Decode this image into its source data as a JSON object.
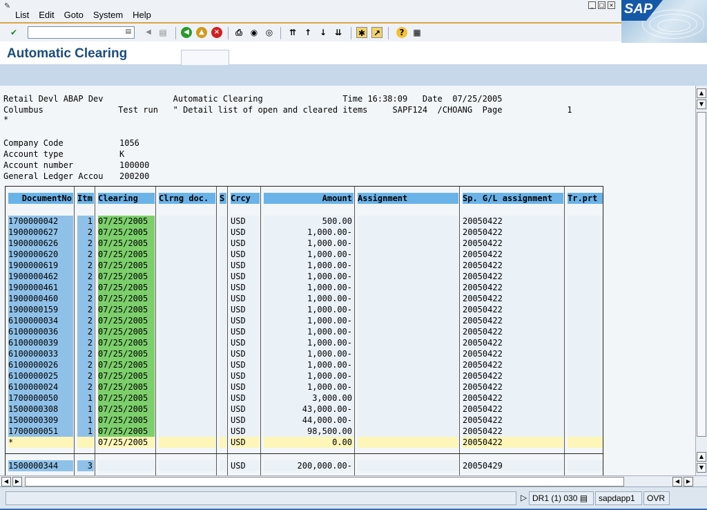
{
  "menu": {
    "items": [
      "List",
      "Edit",
      "Goto",
      "System",
      "Help"
    ]
  },
  "title": "Automatic Clearing",
  "report": {
    "line1": "Retail Devl ABAP Dev              Automatic Clearing                Time 16:38:09   Date  07/25/2005",
    "line2": "Columbus               Test run   \" Detail list of open and cleared items     SAPF124  /CHOANG  Page             1",
    "line3": "*",
    "header_fields": [
      {
        "label": "Company Code",
        "value": "1056"
      },
      {
        "label": "Account type",
        "value": "K"
      },
      {
        "label": "Account number",
        "value": "100000"
      },
      {
        "label": "General Ledger Accou",
        "value": "200200"
      }
    ]
  },
  "table": {
    "headers": [
      "DocumentNo",
      "Itm",
      "Clearing",
      "Clrng doc.",
      "S",
      "Crcy",
      "Amount",
      "Assignment",
      "Sp. G/L assignment",
      "Tr.prt"
    ],
    "rows": [
      [
        "1700000042",
        "1",
        "07/25/2005",
        "",
        "",
        "USD",
        "500.00",
        "",
        "20050422",
        ""
      ],
      [
        "1900000627",
        "2",
        "07/25/2005",
        "",
        "",
        "USD",
        "1,000.00-",
        "",
        "20050422",
        ""
      ],
      [
        "1900000626",
        "2",
        "07/25/2005",
        "",
        "",
        "USD",
        "1,000.00-",
        "",
        "20050422",
        ""
      ],
      [
        "1900000620",
        "2",
        "07/25/2005",
        "",
        "",
        "USD",
        "1,000.00-",
        "",
        "20050422",
        ""
      ],
      [
        "1900000619",
        "2",
        "07/25/2005",
        "",
        "",
        "USD",
        "1,000.00-",
        "",
        "20050422",
        ""
      ],
      [
        "1900000462",
        "2",
        "07/25/2005",
        "",
        "",
        "USD",
        "1,000.00-",
        "",
        "20050422",
        ""
      ],
      [
        "1900000461",
        "2",
        "07/25/2005",
        "",
        "",
        "USD",
        "1,000.00-",
        "",
        "20050422",
        ""
      ],
      [
        "1900000460",
        "2",
        "07/25/2005",
        "",
        "",
        "USD",
        "1,000.00-",
        "",
        "20050422",
        ""
      ],
      [
        "1900000159",
        "2",
        "07/25/2005",
        "",
        "",
        "USD",
        "1,000.00-",
        "",
        "20050422",
        ""
      ],
      [
        "6100000034",
        "2",
        "07/25/2005",
        "",
        "",
        "USD",
        "1,000.00-",
        "",
        "20050422",
        ""
      ],
      [
        "6100000036",
        "2",
        "07/25/2005",
        "",
        "",
        "USD",
        "1,000.00-",
        "",
        "20050422",
        ""
      ],
      [
        "6100000039",
        "2",
        "07/25/2005",
        "",
        "",
        "USD",
        "1,000.00-",
        "",
        "20050422",
        ""
      ],
      [
        "6100000033",
        "2",
        "07/25/2005",
        "",
        "",
        "USD",
        "1,000.00-",
        "",
        "20050422",
        ""
      ],
      [
        "6100000026",
        "2",
        "07/25/2005",
        "",
        "",
        "USD",
        "1,000.00-",
        "",
        "20050422",
        ""
      ],
      [
        "6100000025",
        "2",
        "07/25/2005",
        "",
        "",
        "USD",
        "1,000.00-",
        "",
        "20050422",
        ""
      ],
      [
        "6100000024",
        "2",
        "07/25/2005",
        "",
        "",
        "USD",
        "1,000.00-",
        "",
        "20050422",
        ""
      ],
      [
        "1700000050",
        "1",
        "07/25/2005",
        "",
        "",
        "USD",
        "3,000.00",
        "",
        "20050422",
        ""
      ],
      [
        "1500000308",
        "1",
        "07/25/2005",
        "",
        "",
        "USD",
        "43,000.00-",
        "",
        "20050422",
        ""
      ],
      [
        "1500000309",
        "1",
        "07/25/2005",
        "",
        "",
        "USD",
        "44,000.00-",
        "",
        "20050422",
        ""
      ],
      [
        "1700000051",
        "1",
        "07/25/2005",
        "",
        "",
        "USD",
        "98,500.00",
        "",
        "20050422",
        ""
      ]
    ],
    "subtotal": [
      "*",
      "",
      "07/25/2005",
      "",
      "",
      "USD",
      "0.00",
      "",
      "20050422",
      ""
    ],
    "next_rows": [
      [
        "1500000344",
        "3",
        "",
        "",
        "",
        "USD",
        "200,000.00-",
        "",
        "20050429",
        ""
      ]
    ]
  },
  "status": {
    "system": "DR1 (1) 030",
    "server": "sapdapp1",
    "mode": "OVR"
  },
  "colors": {
    "header_cell": "#6ab3e8",
    "key_cell": "#8fc1e8",
    "clearing_cell": "#7ccf6b",
    "subtotal_row": "#fdf6b8"
  }
}
